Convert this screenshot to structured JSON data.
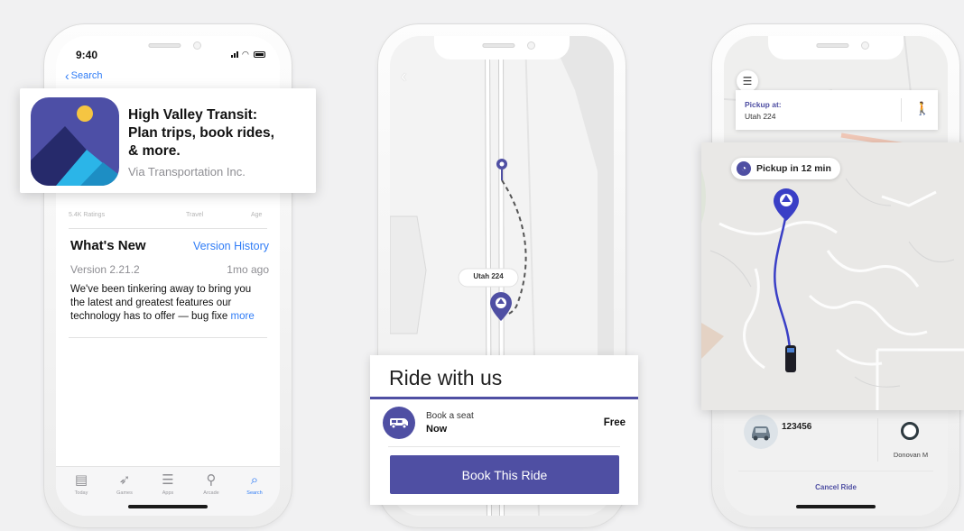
{
  "phone1": {
    "status_time": "9:40",
    "back_label": "Search",
    "app_title_lines": [
      "High Valley Transit:",
      "Plan trips, book rides,",
      "& more."
    ],
    "developer": "Via Transportation Inc.",
    "sub_labels": [
      "5.4K Ratings",
      "Travel",
      "Age"
    ],
    "whats_new_title": "What's New",
    "version_history_link": "Version History",
    "version": "Version 2.21.2",
    "version_age": "1mo ago",
    "description_lines": [
      "We've been tinkering away to bring you",
      "the latest and greatest features our",
      "technology has to offer — bug fixe"
    ],
    "more_link": "more",
    "tabs": [
      {
        "label": "Today",
        "icon": "today-icon",
        "active": false
      },
      {
        "label": "Games",
        "icon": "rocket-icon",
        "active": false
      },
      {
        "label": "Apps",
        "icon": "stack-icon",
        "active": false
      },
      {
        "label": "Arcade",
        "icon": "joystick-icon",
        "active": false
      },
      {
        "label": "Search",
        "icon": "search-icon",
        "active": true
      }
    ]
  },
  "phone2": {
    "map_label": "Utah 224",
    "ride_title": "Ride with us",
    "option_line1": "Book a seat",
    "option_line2": "Now",
    "price": "Free",
    "book_button": "Book This Ride"
  },
  "phone3": {
    "pickup_label": "Pickup at:",
    "pickup_location": "Utah 224",
    "eta_pill": "Pickup in 12 min",
    "vehicle_number": "123456",
    "driver_name": "Donovan M",
    "cancel_button": "Cancel Ride"
  },
  "colors": {
    "accent_purple": "#4f4fa3",
    "ios_blue": "#2f7cf6",
    "route_blue": "#3a3fc6"
  }
}
